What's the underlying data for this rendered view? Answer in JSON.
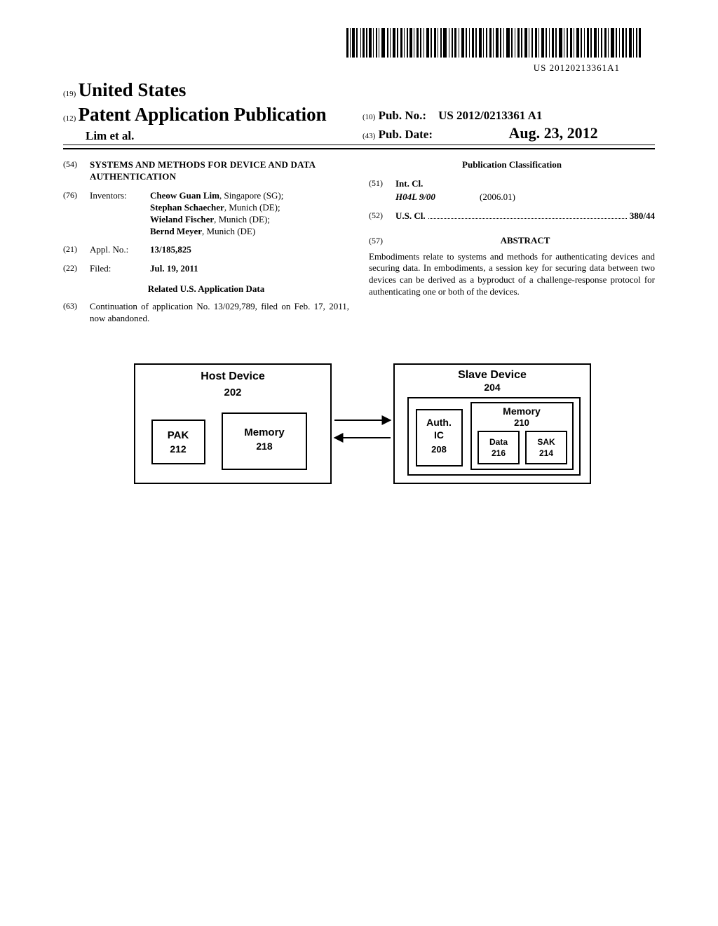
{
  "barcode_text": "US 20120213361A1",
  "header": {
    "code19": "(19)",
    "country": "United States",
    "code12": "(12)",
    "pubtype": "Patent Application Publication",
    "author_line": "Lim et al.",
    "code10": "(10)",
    "pubno_label": "Pub. No.:",
    "pubno_value": "US 2012/0213361 A1",
    "code43": "(43)",
    "pubdate_label": "Pub. Date:",
    "pubdate_value": "Aug. 23, 2012"
  },
  "left": {
    "title_code": "(54)",
    "title": "SYSTEMS AND METHODS FOR DEVICE AND DATA AUTHENTICATION",
    "inventors_code": "(76)",
    "inventors_label": "Inventors:",
    "inventors": [
      {
        "name": "Cheow Guan Lim",
        "loc": ", Singapore (SG);"
      },
      {
        "name": "Stephan Schaecher",
        "loc": ", Munich (DE);"
      },
      {
        "name": "Wieland Fischer",
        "loc": ", Munich (DE);"
      },
      {
        "name": "Bernd Meyer",
        "loc": ", Munich (DE)"
      }
    ],
    "appl_code": "(21)",
    "appl_label": "Appl. No.:",
    "appl_value": "13/185,825",
    "filed_code": "(22)",
    "filed_label": "Filed:",
    "filed_value": "Jul. 19, 2011",
    "related_heading": "Related U.S. Application Data",
    "cont_code": "(63)",
    "cont_text": "Continuation of application No. 13/029,789, filed on Feb. 17, 2011, now abandoned."
  },
  "right": {
    "class_heading": "Publication Classification",
    "intcl_code": "(51)",
    "intcl_label": "Int. Cl.",
    "intcl_symbol": "H04L 9/00",
    "intcl_date": "(2006.01)",
    "uscl_code": "(52)",
    "uscl_label": "U.S. Cl.",
    "uscl_value": "380/44",
    "abstract_code": "(57)",
    "abstract_heading": "ABSTRACT",
    "abstract_text": "Embodiments relate to systems and methods for authenticating devices and securing data. In embodiments, a session key for securing data between two devices can be derived as a byproduct of a challenge-response protocol for authenticating one or both of the devices."
  },
  "figure": {
    "host_title": "Host Device",
    "host_ref": "202",
    "pak_label": "PAK",
    "pak_ref": "212",
    "host_mem_label": "Memory",
    "host_mem_ref": "218",
    "slave_title": "Slave Device",
    "slave_ref": "204",
    "authic_l1": "Auth.",
    "authic_l2": "IC",
    "authic_ref": "208",
    "slave_mem_label": "Memory",
    "slave_mem_ref": "210",
    "data_label": "Data",
    "data_ref": "216",
    "sak_label": "SAK",
    "sak_ref": "214"
  }
}
